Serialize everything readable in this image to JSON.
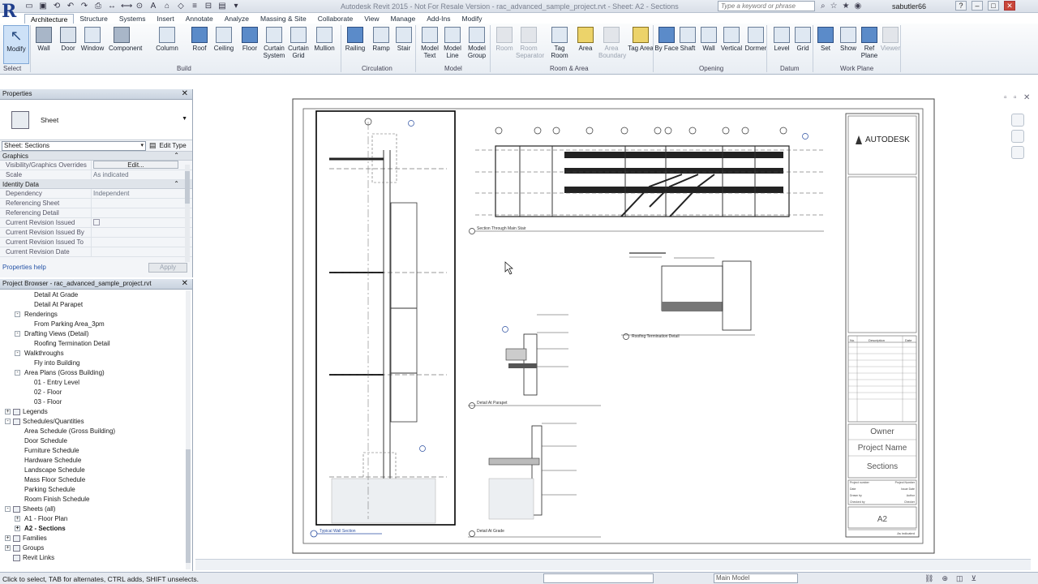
{
  "window": {
    "title": "Autodesk Revit 2015 - Not For Resale Version - rac_advanced_sample_project.rvt - Sheet: A2 - Sections",
    "search_placeholder": "Type a keyword or phrase",
    "user": "sabutler66"
  },
  "ribbon_tabs": [
    "Architecture",
    "Structure",
    "Systems",
    "Insert",
    "Annotate",
    "Analyze",
    "Massing & Site",
    "Collaborate",
    "View",
    "Manage",
    "Add-Ins",
    "Modify"
  ],
  "active_tab": "Architecture",
  "ribbon": {
    "panels": [
      "Select",
      "Build",
      "Circulation",
      "Model",
      "Room & Area",
      "Opening",
      "Datum",
      "Work Plane"
    ],
    "tools": [
      {
        "label": "Modify",
        "icon": "cursor-icon"
      },
      {
        "label": "Wall",
        "icon": "wall-icon"
      },
      {
        "label": "Door",
        "icon": "door-icon"
      },
      {
        "label": "Window",
        "icon": "window-icon"
      },
      {
        "label": "Component",
        "icon": "component-icon"
      },
      {
        "label": "Column",
        "icon": "column-icon"
      },
      {
        "label": "Roof",
        "icon": "roof-icon"
      },
      {
        "label": "Ceiling",
        "icon": "ceiling-icon"
      },
      {
        "label": "Floor",
        "icon": "floor-icon"
      },
      {
        "label": "Curtain System",
        "icon": "curtain-system-icon"
      },
      {
        "label": "Curtain Grid",
        "icon": "curtain-grid-icon"
      },
      {
        "label": "Mullion",
        "icon": "mullion-icon"
      },
      {
        "label": "Railing",
        "icon": "railing-icon"
      },
      {
        "label": "Ramp",
        "icon": "ramp-icon"
      },
      {
        "label": "Stair",
        "icon": "stair-icon"
      },
      {
        "label": "Model Text",
        "icon": "model-text-icon"
      },
      {
        "label": "Model Line",
        "icon": "model-line-icon"
      },
      {
        "label": "Model Group",
        "icon": "model-group-icon"
      },
      {
        "label": "Room",
        "icon": "room-icon"
      },
      {
        "label": "Room Separator",
        "icon": "room-separator-icon"
      },
      {
        "label": "Tag Room",
        "icon": "tag-room-icon"
      },
      {
        "label": "Area",
        "icon": "area-icon"
      },
      {
        "label": "Area Boundary",
        "icon": "area-boundary-icon"
      },
      {
        "label": "Tag Area",
        "icon": "tag-area-icon"
      },
      {
        "label": "By Face",
        "icon": "by-face-icon"
      },
      {
        "label": "Shaft",
        "icon": "shaft-icon"
      },
      {
        "label": "Wall",
        "icon": "wall-opening-icon"
      },
      {
        "label": "Vertical",
        "icon": "vertical-icon"
      },
      {
        "label": "Dormer",
        "icon": "dormer-icon"
      },
      {
        "label": "Level",
        "icon": "level-icon"
      },
      {
        "label": "Grid",
        "icon": "grid-icon"
      },
      {
        "label": "Set",
        "icon": "set-icon"
      },
      {
        "label": "Show",
        "icon": "show-icon"
      },
      {
        "label": "Ref Plane",
        "icon": "ref-plane-icon"
      },
      {
        "label": "Viewer",
        "icon": "viewer-icon"
      }
    ]
  },
  "properties": {
    "title": "Properties",
    "type_name": "Sheet",
    "instance": "Sheet: Sections",
    "edit_type": "Edit Type",
    "groups": [
      {
        "name": "Graphics",
        "rows": [
          {
            "key": "Visibility/Graphics Overrides",
            "value": "Edit..."
          },
          {
            "key": "Scale",
            "value": "As indicated"
          }
        ]
      },
      {
        "name": "Identity Data",
        "rows": [
          {
            "key": "Dependency",
            "value": "Independent"
          },
          {
            "key": "Referencing Sheet",
            "value": ""
          },
          {
            "key": "Referencing Detail",
            "value": ""
          },
          {
            "key": "Current Revision Issued",
            "value": ""
          },
          {
            "key": "Current Revision Issued By",
            "value": ""
          },
          {
            "key": "Current Revision Issued To",
            "value": ""
          },
          {
            "key": "Current Revision Date",
            "value": ""
          }
        ]
      }
    ],
    "help_link": "Properties help",
    "apply": "Apply"
  },
  "project_browser": {
    "title": "Project Browser - rac_advanced_sample_project.rvt",
    "nodes": [
      {
        "label": "Detail At Grade",
        "level": 3
      },
      {
        "label": "Detail At Parapet",
        "level": 3
      },
      {
        "label": "Renderings",
        "level": 2,
        "exp": "-"
      },
      {
        "label": "From Parking Area_3pm",
        "level": 3
      },
      {
        "label": "Drafting Views (Detail)",
        "level": 2,
        "exp": "-"
      },
      {
        "label": "Roofing Termination Detail",
        "level": 3
      },
      {
        "label": "Walkthroughs",
        "level": 2,
        "exp": "-"
      },
      {
        "label": "Fly into Building",
        "level": 3
      },
      {
        "label": "Area Plans (Gross Building)",
        "level": 2,
        "exp": "-"
      },
      {
        "label": "01 - Entry Level",
        "level": 3
      },
      {
        "label": "02 - Floor",
        "level": 3
      },
      {
        "label": "03 - Floor",
        "level": 3
      },
      {
        "label": "Legends",
        "level": 1,
        "exp": "+",
        "icon": true
      },
      {
        "label": "Schedules/Quantities",
        "level": 1,
        "exp": "-",
        "icon": true
      },
      {
        "label": "Area Schedule (Gross Building)",
        "level": 2
      },
      {
        "label": "Door Schedule",
        "level": 2
      },
      {
        "label": "Furniture Schedule",
        "level": 2
      },
      {
        "label": "Hardware Schedule",
        "level": 2
      },
      {
        "label": "Landscape Schedule",
        "level": 2
      },
      {
        "label": "Mass Floor Schedule",
        "level": 2
      },
      {
        "label": "Parking Schedule",
        "level": 2
      },
      {
        "label": "Room Finish Schedule",
        "level": 2
      },
      {
        "label": "Sheets (all)",
        "level": 1,
        "exp": "-",
        "icon": true
      },
      {
        "label": "A1 - Floor Plan",
        "level": 2,
        "exp": "+"
      },
      {
        "label": "A2 - Sections",
        "level": 2,
        "exp": "+",
        "selected": true
      },
      {
        "label": "Families",
        "level": 1,
        "exp": "+",
        "icon": true
      },
      {
        "label": "Groups",
        "level": 1,
        "exp": "+",
        "icon": true
      },
      {
        "label": "Revit Links",
        "level": 1,
        "icon": true
      }
    ]
  },
  "sheet": {
    "company": "AUTODESK",
    "owner": "Owner",
    "project_name": "Project Name",
    "sheet_name": "Sections",
    "sheet_number": "A2",
    "revision_headers": [
      "No.",
      "Description",
      "Date"
    ],
    "titleblock_fields": [
      {
        "k": "Project number",
        "v": "Project Number"
      },
      {
        "k": "Date",
        "v": "Issue Date"
      },
      {
        "k": "Drawn by",
        "v": "Author"
      },
      {
        "k": "Checked by",
        "v": "Checker"
      }
    ],
    "scale_value": "As indicated",
    "views": [
      "Section Through Main Stair",
      "Roofing Termination Detail",
      "Detail At Parapet",
      "Detail At Grade",
      "Typical Wall Section"
    ]
  },
  "status": {
    "message": "Click to select, TAB for alternates, CTRL adds, SHIFT unselects.",
    "model": "Main Model"
  }
}
